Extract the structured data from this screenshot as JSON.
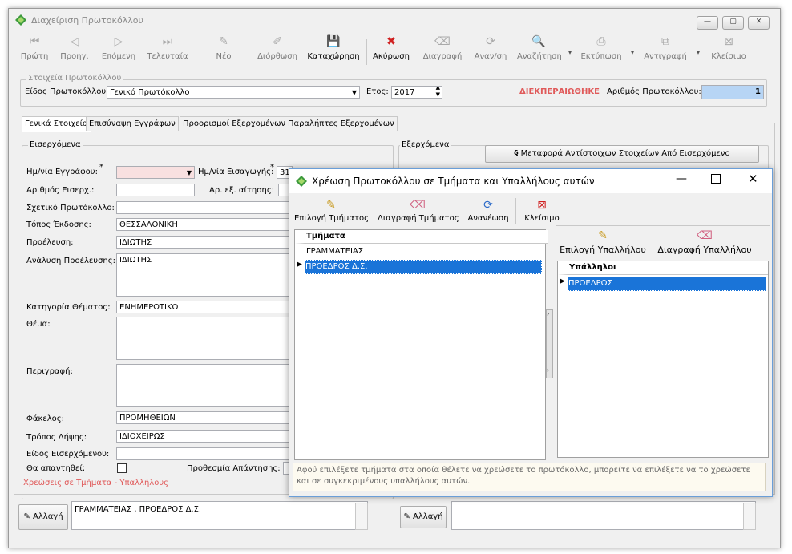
{
  "window": {
    "title": "Διαχείριση Πρωτοκόλλου"
  },
  "toolbar": {
    "first": "Πρώτη",
    "prev": "Προηγ.",
    "next": "Επόμενη",
    "last": "Τελευταία",
    "new": "Νέο",
    "edit": "Διόρθωση",
    "save": "Καταχώρηση",
    "cancel": "Ακύρωση",
    "delete": "Διαγραφή",
    "refresh": "Αναν/ση",
    "search": "Αναζήτηση",
    "print": "Εκτύπωση",
    "copy": "Αντιγραφή",
    "close": "Κλείσιμο"
  },
  "header": {
    "group_title": "Στοιχεία Πρωτοκόλλου",
    "type_label": "Είδος Πρωτοκόλλου:",
    "type_value": "Γενικό Πρωτόκολλο",
    "year_label": "Ετος:",
    "year_value": "2017",
    "status": "ΔΙΕΚΠΕΡΑΙΩΘΗΚΕ",
    "number_label": "Αριθμός Πρωτοκόλλου:",
    "number_value": "1"
  },
  "tabs": [
    "Γενικά Στοιχεία",
    "Επισύναψη Εγγράφων",
    "Προορισμοί Εξερχομένων",
    "Παραλήπτες Εξερχομένων"
  ],
  "incoming": {
    "group_title": "Εισερχόμενα",
    "doc_date_label": "Ημ/νία Εγγράφου:",
    "entry_date_label": "Ημ/νία Εισαγωγής:",
    "entry_date_value": "31",
    "asterisk": "*",
    "incoming_no_label": "Αριθμός Εισερχ.:",
    "request_no_label": "Αρ. εξ. αίτησης:",
    "related_label": "Σχετικό Πρωτόκολλο:",
    "place_label": "Τόπος Έκδοσης:",
    "place_value": "ΘΕΣΣΑΛΟΝΙΚΗ",
    "origin_label": "Προέλευση:",
    "origin_value": "ΙΔΙΩΤΗΣ",
    "origin_detail_label": "Ανάλυση Προέλευσης:",
    "origin_detail_value": "ΙΔΙΩΤΗΣ",
    "category_label": "Κατηγορία Θέματος:",
    "category_value": "ΕΝΗΜΕΡΩΤΙΚΟ",
    "subject_label": "Θέμα:",
    "description_label": "Περιγραφή:",
    "folder_label": "Φάκελος:",
    "folder_value": "ΠΡΟΜΗΘΕΙΩΝ",
    "receipt_label": "Τρόπος Λήψης:",
    "receipt_value": "ΙΔΙΟΧΕΙΡΩΣ",
    "incoming_type_label": "Είδος Εισερχόμενου:",
    "to_answer_label": "Θα απαντηθεί;",
    "deadline_label": "Προθεσμία Απάντησης:",
    "charges_link": "Χρεώσεις σε Τμήματα - Υπαλλήλους"
  },
  "outgoing": {
    "group_title": "Εξερχόμενα",
    "transfer_button": "Μεταφορά Αντίστοιχων Στοιχείων Από Εισερχόμενο"
  },
  "bottom": {
    "change_label": "Αλλαγή",
    "charges_text": "ΓΡΑΜΜΑΤΕΙΑΣ , ΠΡΟΕΔΡΟΣ Δ.Σ.",
    "change_label_2": "Αλλαγή"
  },
  "dialog": {
    "title": "Χρέωση Πρωτοκόλλου σε Τμήματα και Υπαλλήλους αυτών",
    "toolbar": {
      "select_dept": "Επιλογή Τμήματος",
      "delete_dept": "Διαγραφή Τμήματος",
      "refresh": "Ανανέωση",
      "close": "Κλείσιμο"
    },
    "emp_toolbar": {
      "select_emp": "Επιλογή Υπαλλήλου",
      "delete_emp": "Διαγραφή Υπαλλήλου"
    },
    "departments_header": "Τμήματα",
    "departments": [
      "ΓΡΑΜΜΑΤΕΙΑΣ",
      "ΠΡΟΕΔΡΟΣ Δ.Σ."
    ],
    "employees_header": "Υπάλληλοι",
    "employees": [
      "ΠΡΟΕΔΡΟΣ"
    ],
    "hint": "Αφού επιλέξετε τμήματα στα οποία θέλετε να χρεώσετε το πρωτόκολλο, μπορείτε να επιλέξετε να το χρεώσετε και σε συγκεκριμένους υπαλλήλους αυτών."
  },
  "colors": {
    "status": "#e05a5a",
    "link": "#e05a5a",
    "selection": "#1a74d8",
    "number_bg": "#b7d5f5"
  }
}
